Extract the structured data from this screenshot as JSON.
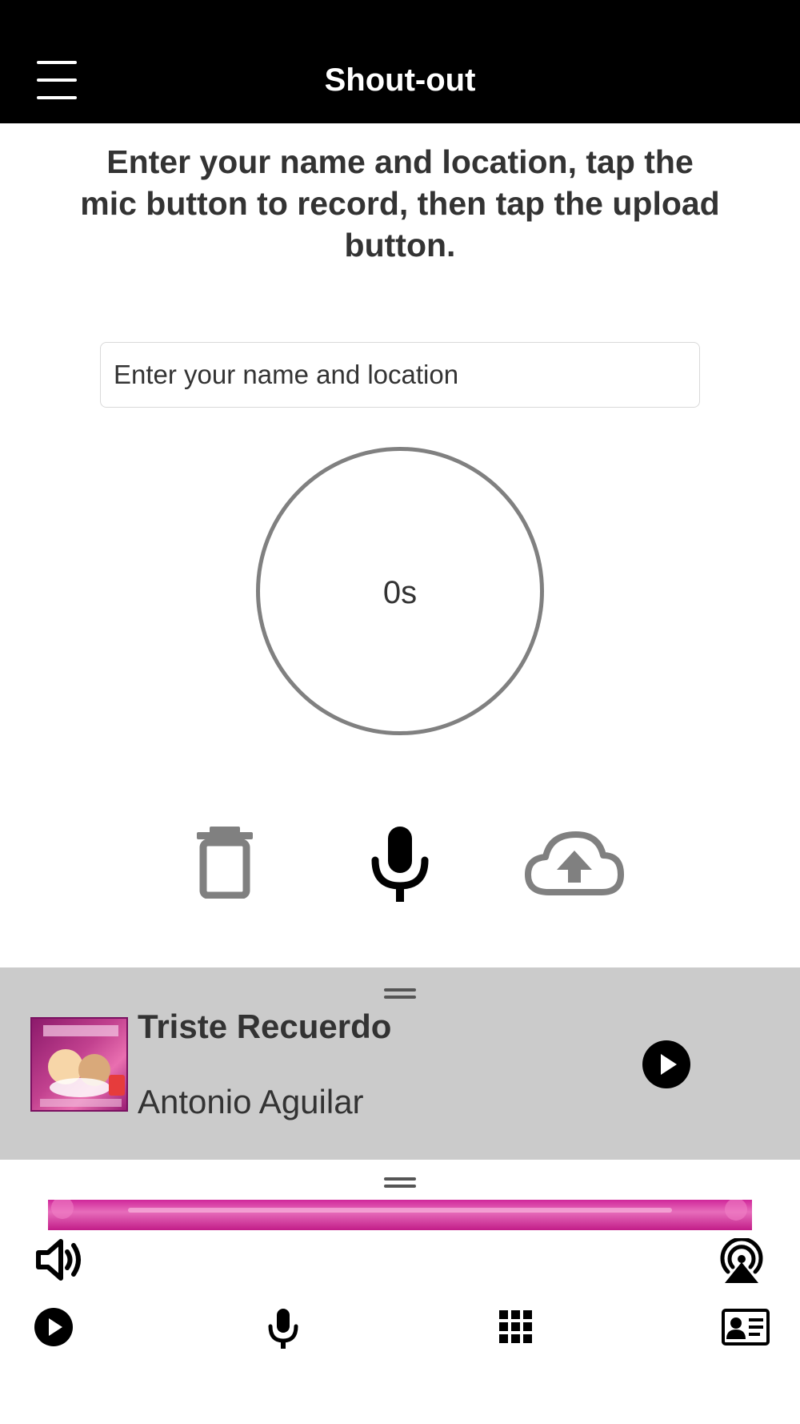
{
  "header": {
    "title": "Shout-out",
    "menu_icon": "hamburger-menu-icon"
  },
  "instructions": "Enter your name and location, tap the mic button to record, then tap the upload button.",
  "name_input": {
    "placeholder": "Enter your name and location",
    "value": ""
  },
  "recorder": {
    "elapsed": "0s",
    "delete_icon": "trash-icon",
    "record_icon": "microphone-icon",
    "upload_icon": "cloud-upload-icon"
  },
  "now_playing": {
    "title": "Triste Recuerdo",
    "artist": "Antonio Aguilar",
    "album_art": "album-cover-historia-de-la-musica-mexicana",
    "play_icon": "play-circle-icon",
    "drag_icon": "drag-handle-icon"
  },
  "bottom_bar": {
    "volume_icon": "speaker-volume-icon",
    "airplay_icon": "airplay-icon",
    "nav": [
      "play-circle-icon",
      "microphone-icon",
      "grid-icon",
      "contact-card-icon"
    ]
  },
  "colors": {
    "header_bg": "#000000",
    "player_bg": "#cbcbcb",
    "text": "#333333",
    "circle": "#808080",
    "banner": "#d0279a"
  }
}
